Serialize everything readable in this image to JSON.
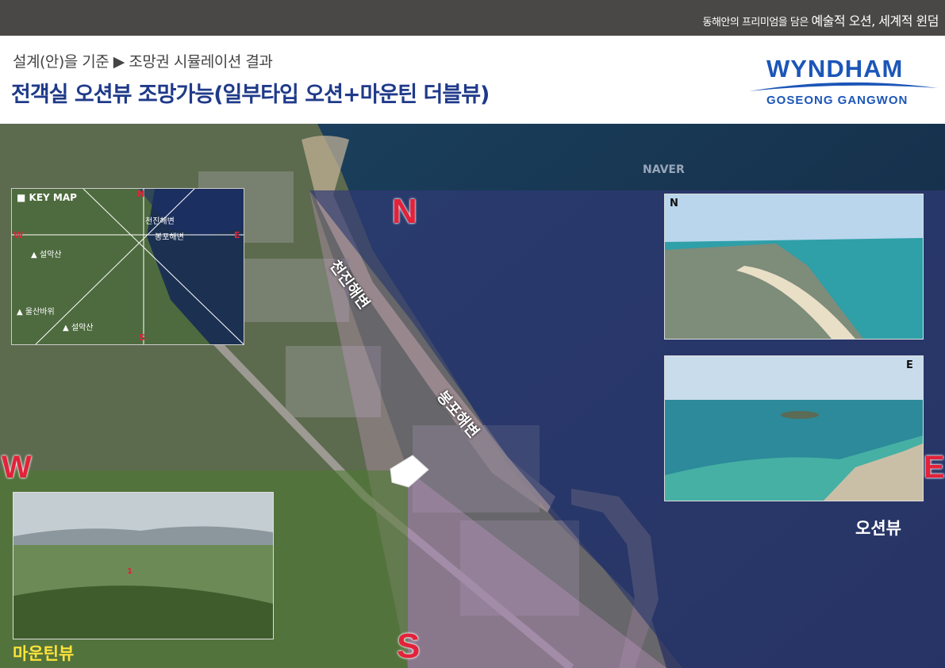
{
  "topbar": {
    "tagline_prefix": "동해안의 프리미엄을 담은 ",
    "tagline_emph": "예술적 오션, 세계적 윈덤"
  },
  "header": {
    "subtitle": "설계(안)을 기준 ▶ 조망권 시뮬레이션 결과",
    "title": "전객실 오션뷰 조망가능(일부타입 오션+마운틴 더블뷰)"
  },
  "logo": {
    "brand": "WYNDHAM",
    "location": "GOSEONG GANGWON",
    "color": "#1c56b8"
  },
  "map": {
    "watermark": "NAVER",
    "compass": {
      "north": "N",
      "east": "E",
      "south": "S",
      "west": "W"
    },
    "beaches": [
      "천진해변",
      "봉포해변"
    ],
    "accent_color": "#e2223a"
  },
  "keymap": {
    "title": "■ KEY MAP",
    "dirs": {
      "n": "N",
      "e": "E",
      "s": "S",
      "w": "W"
    },
    "labels": [
      "천진해변",
      "봉포해변",
      "▲ 설악산",
      "▲ 울산바위",
      "▲ 설악산"
    ]
  },
  "photos": {
    "north": {
      "dir": "N"
    },
    "east": {
      "dir": "E"
    },
    "mountain": {
      "marker": "1"
    }
  },
  "views": {
    "ocean": "오션뷰",
    "mountain": "마운틴뷰"
  }
}
